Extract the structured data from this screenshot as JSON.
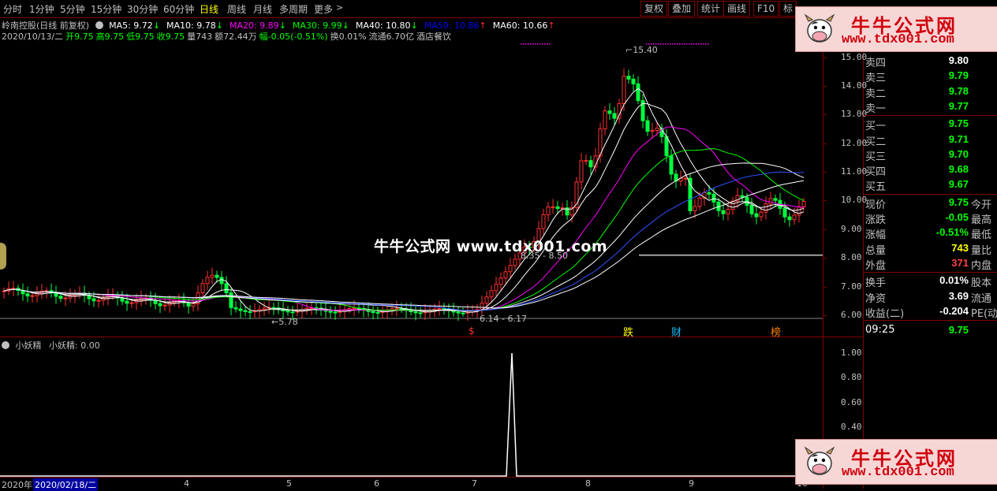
{
  "toolbar": {
    "periods": [
      "分时",
      "1分钟",
      "5分钟",
      "15分钟",
      "30分钟",
      "60分钟",
      "日线",
      "周线",
      "月线",
      "多周期",
      "更多"
    ],
    "active_period": "日线",
    "more_arrow": ">",
    "buttons": [
      "复权",
      "叠加",
      "统计",
      "画线",
      "F10",
      "标"
    ]
  },
  "header": {
    "title": "岭南控股(日线 前复权)",
    "ma": [
      {
        "label": "MA5: 9.72",
        "arrow": "↓",
        "color": "#ffffff"
      },
      {
        "label": "MA10: 9.78",
        "arrow": "↓",
        "color": "#ffffff"
      },
      {
        "label": "MA20: 9.89",
        "arrow": "↓",
        "color": "#ff00ff"
      },
      {
        "label": "MA30: 9.99",
        "arrow": "↓",
        "color": "#00ff00"
      },
      {
        "label": "MA40: 10.80",
        "arrow": "↓",
        "color": "#ffffff"
      },
      {
        "label": "MA50: 10.86",
        "arrow": "↑",
        "color": "#0000ff"
      },
      {
        "label": "MA60: 10.66",
        "arrow": "↑",
        "color": "#ffffff"
      }
    ],
    "quote_line": [
      {
        "text": "2020/10/13/二",
        "color": "#c0c0c0"
      },
      {
        "text": "开9.75",
        "color": "#00ff00"
      },
      {
        "text": "高9.75",
        "color": "#00ff00"
      },
      {
        "text": "低9.75",
        "color": "#00ff00"
      },
      {
        "text": "收9.75",
        "color": "#00ff00"
      },
      {
        "text": "量743",
        "color": "#c0c0c0"
      },
      {
        "text": "额72.44万",
        "color": "#c0c0c0"
      },
      {
        "text": "幅-0.05(-0.51%)",
        "color": "#00ff00"
      },
      {
        "text": "换0.01%",
        "color": "#c0c0c0"
      },
      {
        "text": "流通6.70亿",
        "color": "#c0c0c0"
      },
      {
        "text": "酒店餐饮",
        "color": "#c0c0c0"
      }
    ]
  },
  "price_axis": [
    "15.00",
    "14.00",
    "13.00",
    "12.00",
    "11.00",
    "10.00",
    "9.00",
    "8.00",
    "7.00",
    "6.00"
  ],
  "annotations": {
    "high": "15.40",
    "low_early": "5.78",
    "range_mid": "8.35 - 8.50",
    "range_low": "6.14 - 6.17",
    "markers": [
      {
        "text": "$",
        "color": "#ff3030"
      },
      {
        "text": "跌",
        "color": "#ffff00"
      },
      {
        "text": "财",
        "color": "#00c0ff"
      },
      {
        "text": "榜",
        "color": "#ff8000"
      }
    ]
  },
  "watermark": {
    "center": "牛牛公式网 www.tdx001.com",
    "box_title": "牛牛公式网",
    "box_url": "www.tdx001.com"
  },
  "orderbook": {
    "sell": [
      {
        "label": "卖四",
        "value": "9.80",
        "color": "#ffffff"
      },
      {
        "label": "卖三",
        "value": "9.79",
        "color": "#00ff00"
      },
      {
        "label": "卖二",
        "value": "9.78",
        "color": "#00ff00"
      },
      {
        "label": "卖一",
        "value": "9.77",
        "color": "#00ff00"
      }
    ],
    "buy": [
      {
        "label": "买一",
        "value": "9.75",
        "color": "#00ff00"
      },
      {
        "label": "买二",
        "value": "9.71",
        "color": "#00ff00"
      },
      {
        "label": "买三",
        "value": "9.70",
        "color": "#00ff00"
      },
      {
        "label": "买四",
        "value": "9.68",
        "color": "#00ff00"
      },
      {
        "label": "买五",
        "value": "9.67",
        "color": "#00ff00"
      }
    ],
    "stats": [
      {
        "label": "现价",
        "value": "9.75",
        "color": "#00ff00",
        "extra": "今开"
      },
      {
        "label": "涨跌",
        "value": "-0.05",
        "color": "#00ff00",
        "extra": "最高"
      },
      {
        "label": "涨幅",
        "value": "-0.51%",
        "color": "#00ff00",
        "extra": "最低"
      },
      {
        "label": "总量",
        "value": "743",
        "color": "#ffff00",
        "extra": "量比"
      },
      {
        "label": "外盘",
        "value": "371",
        "color": "#ff4040",
        "extra": "内盘"
      }
    ],
    "fundamentals": [
      {
        "label": "换手",
        "value": "0.01%",
        "color": "#ffffff",
        "extra": "股本"
      },
      {
        "label": "净资",
        "value": "3.69",
        "color": "#ffffff",
        "extra": "流通"
      },
      {
        "label": "收益(二)",
        "value": "-0.204",
        "color": "#ffffff",
        "extra": "PE(动"
      }
    ],
    "tick": {
      "time": "09:25",
      "value": "9.75",
      "color": "#00ff00"
    }
  },
  "indicator": {
    "title": "小妖精",
    "value_line": "小妖精: 0.00",
    "axis": [
      "1.00",
      "0.80",
      "0.60",
      "0.40"
    ]
  },
  "date_axis": {
    "start": "2020年",
    "cursor_date": "2020/02/18/二",
    "months": [
      "4",
      "5",
      "6",
      "7",
      "8",
      "9",
      "10"
    ]
  },
  "chart_data": {
    "type": "candlestick",
    "y_range": [
      5.6,
      15.6
    ],
    "spike": {
      "indicator_value": 1.0,
      "baseline": 0.0
    }
  }
}
